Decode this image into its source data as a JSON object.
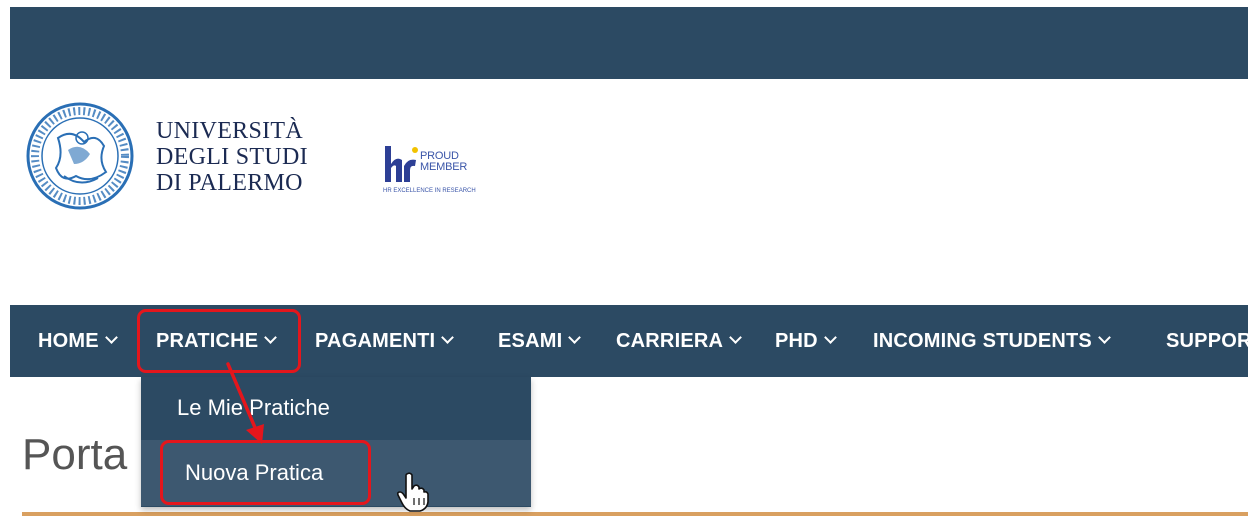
{
  "header": {
    "university_name": [
      "UNIVERSITÀ",
      "DEGLI STUDI",
      "DI PALERMO"
    ],
    "hr_badge": {
      "logo_text": "hr",
      "line1": "PROUD",
      "line2": "MEMBER",
      "subtitle": "HR EXCELLENCE IN RESEARCH"
    },
    "seal_icon": "university-seal-icon"
  },
  "nav": {
    "items": [
      {
        "label": "HOME"
      },
      {
        "label": "PRATICHE"
      },
      {
        "label": "PAGAMENTI"
      },
      {
        "label": "ESAMI"
      },
      {
        "label": "CARRIERA"
      },
      {
        "label": "PHD"
      },
      {
        "label": "INCOMING STUDENTS"
      },
      {
        "label": "SUPPOR"
      }
    ]
  },
  "dropdown": {
    "items": [
      {
        "label": "Le Mie Pratiche"
      },
      {
        "label": "Nuova Pratica"
      }
    ]
  },
  "page": {
    "title": "Porta"
  },
  "colors": {
    "navbar_bg": "#2c4a63",
    "highlight": "#e4161c",
    "accent_line": "#d9a060"
  }
}
